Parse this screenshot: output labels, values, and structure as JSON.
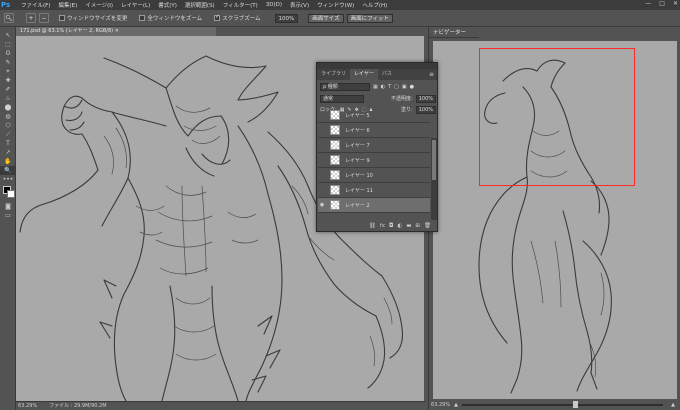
{
  "menubar": {
    "logo": "Ps",
    "items": [
      "ファイル(F)",
      "編集(E)",
      "イメージ(I)",
      "レイヤー(L)",
      "書式(Y)",
      "選択範囲(S)",
      "フィルター(T)",
      "3D(D)",
      "表示(V)",
      "ウィンドウ(W)",
      "ヘルプ(H)"
    ],
    "window_controls": [
      "—",
      "□",
      "✕"
    ]
  },
  "options": {
    "tool_icon": "magnifier-icon",
    "zoom_in": "+",
    "zoom_out": "−",
    "resize_windows_label": "ウィンドウサイズを変更",
    "resize_windows_checked": false,
    "zoom_all_label": "全ウィンドウをズーム",
    "zoom_all_checked": false,
    "scrubby_zoom_label": "スクラブズーム",
    "scrubby_zoom_checked": true,
    "percent": "100%",
    "fit_screen": "画面サイズ",
    "fill_screen": "画面にフィット"
  },
  "tools": [
    "↖",
    "⬚",
    "ʘ",
    "✎",
    "⌖",
    "✚",
    "✐",
    "♨",
    "⬤",
    "◍",
    "⬡",
    "⟋",
    "T",
    "↗",
    "✋",
    "🔍"
  ],
  "document": {
    "tab_title": "171.psd @ 63.1% (レイヤー 2, RGB/8)"
  },
  "status": {
    "zoom": "63.29%",
    "file_info": "ファイル : 29.9M/90.2M"
  },
  "navigator": {
    "title": "ナビゲーター",
    "zoom": "63.29%",
    "slider_level": 0.55
  },
  "layers": {
    "tabs": [
      "ライブラリ",
      "レイヤー",
      "パス"
    ],
    "active_tab": 1,
    "kind_filter": "ρ 種類",
    "blend_mode": "通常",
    "opacity_label": "不透明度:",
    "opacity": "100%",
    "lock_label": "ロック:",
    "fill_label": "塗り:",
    "fill": "100%",
    "items": [
      {
        "name": "レイヤー 5",
        "selected": false,
        "visible": false
      },
      {
        "name": "レイヤー 6",
        "selected": false,
        "visible": false
      },
      {
        "name": "レイヤー 7",
        "selected": false,
        "visible": false
      },
      {
        "name": "レイヤー 9",
        "selected": false,
        "visible": false
      },
      {
        "name": "レイヤー 10",
        "selected": false,
        "visible": false
      },
      {
        "name": "レイヤー 11",
        "selected": false,
        "visible": false
      },
      {
        "name": "レイヤー 2",
        "selected": true,
        "visible": true
      }
    ],
    "footer_icons": [
      "link-icon",
      "fx-icon",
      "mask-icon",
      "adjustment-icon",
      "folder-icon",
      "new-layer-icon",
      "trash-icon"
    ]
  },
  "colors": {
    "canvas": "#a9a9a9",
    "nav_box": "#ff2b2b",
    "ps_blue": "#31a8ff"
  }
}
